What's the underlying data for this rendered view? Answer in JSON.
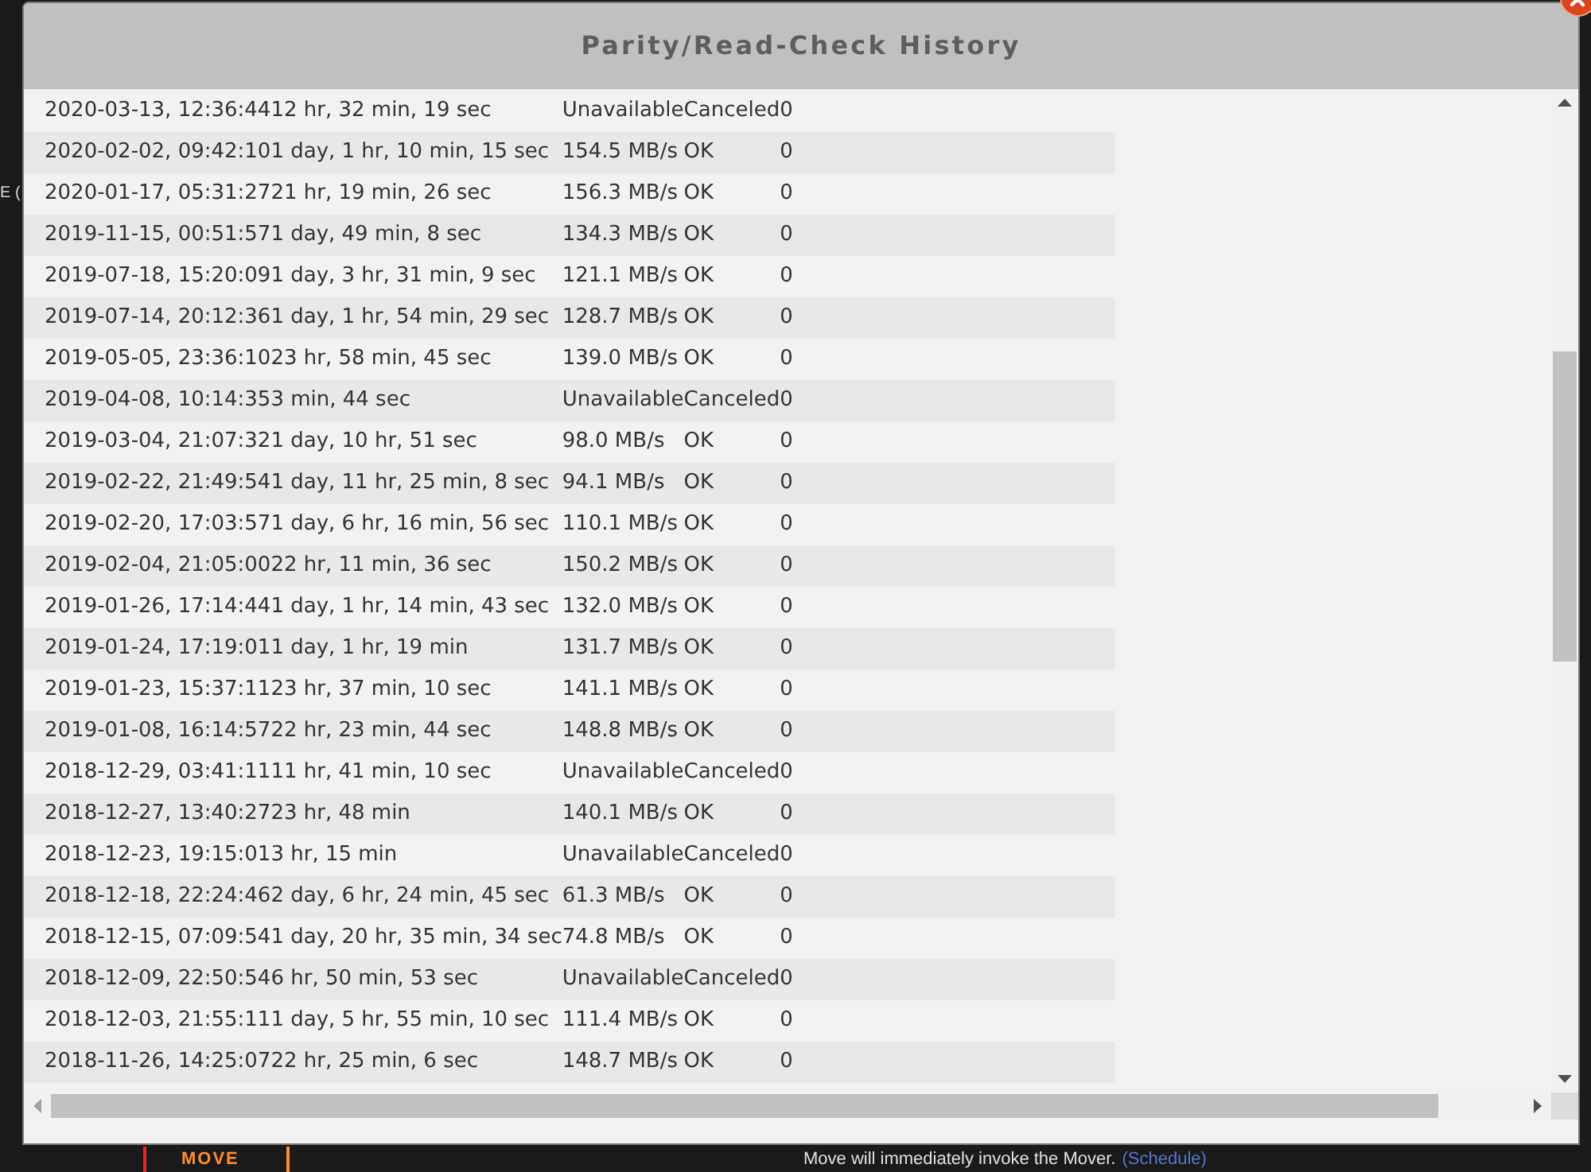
{
  "background": {
    "fragment": "E (",
    "move_button": "MOVE",
    "move_note": {
      "text": "Move will immediately invoke the Mover.",
      "link": "(Schedule)"
    }
  },
  "dialog": {
    "title": "Parity/Read-Check History",
    "rows": [
      {
        "date": "2020-03-13, 12:36:44",
        "duration": "12 hr, 32 min, 19 sec",
        "speed": "Unavailable",
        "status": "Canceled",
        "errors": "0"
      },
      {
        "date": "2020-02-02, 09:42:10",
        "duration": "1 day, 1 hr, 10 min, 15 sec",
        "speed": "154.5 MB/s",
        "status": "OK",
        "errors": "0"
      },
      {
        "date": "2020-01-17, 05:31:27",
        "duration": "21 hr, 19 min, 26 sec",
        "speed": "156.3 MB/s",
        "status": "OK",
        "errors": "0"
      },
      {
        "date": "2019-11-15, 00:51:57",
        "duration": "1 day, 49 min, 8 sec",
        "speed": "134.3 MB/s",
        "status": "OK",
        "errors": "0"
      },
      {
        "date": "2019-07-18, 15:20:09",
        "duration": "1 day, 3 hr, 31 min, 9 sec",
        "speed": "121.1 MB/s",
        "status": "OK",
        "errors": "0"
      },
      {
        "date": "2019-07-14, 20:12:36",
        "duration": "1 day, 1 hr, 54 min, 29 sec",
        "speed": "128.7 MB/s",
        "status": "OK",
        "errors": "0"
      },
      {
        "date": "2019-05-05, 23:36:10",
        "duration": "23 hr, 58 min, 45 sec",
        "speed": "139.0 MB/s",
        "status": "OK",
        "errors": "0"
      },
      {
        "date": "2019-04-08, 10:14:35",
        "duration": "3 min, 44 sec",
        "speed": "Unavailable",
        "status": "Canceled",
        "errors": "0"
      },
      {
        "date": "2019-03-04, 21:07:32",
        "duration": "1 day, 10 hr, 51 sec",
        "speed": "98.0 MB/s",
        "status": "OK",
        "errors": "0"
      },
      {
        "date": "2019-02-22, 21:49:54",
        "duration": "1 day, 11 hr, 25 min, 8 sec",
        "speed": "94.1 MB/s",
        "status": "OK",
        "errors": "0"
      },
      {
        "date": "2019-02-20, 17:03:57",
        "duration": "1 day, 6 hr, 16 min, 56 sec",
        "speed": "110.1 MB/s",
        "status": "OK",
        "errors": "0"
      },
      {
        "date": "2019-02-04, 21:05:00",
        "duration": "22 hr, 11 min, 36 sec",
        "speed": "150.2 MB/s",
        "status": "OK",
        "errors": "0"
      },
      {
        "date": "2019-01-26, 17:14:44",
        "duration": "1 day, 1 hr, 14 min, 43 sec",
        "speed": "132.0 MB/s",
        "status": "OK",
        "errors": "0"
      },
      {
        "date": "2019-01-24, 17:19:01",
        "duration": "1 day, 1 hr, 19 min",
        "speed": "131.7 MB/s",
        "status": "OK",
        "errors": "0"
      },
      {
        "date": "2019-01-23, 15:37:11",
        "duration": "23 hr, 37 min, 10 sec",
        "speed": "141.1 MB/s",
        "status": "OK",
        "errors": "0"
      },
      {
        "date": "2019-01-08, 16:14:57",
        "duration": "22 hr, 23 min, 44 sec",
        "speed": "148.8 MB/s",
        "status": "OK",
        "errors": "0"
      },
      {
        "date": "2018-12-29, 03:41:11",
        "duration": "11 hr, 41 min, 10 sec",
        "speed": "Unavailable",
        "status": "Canceled",
        "errors": "0"
      },
      {
        "date": "2018-12-27, 13:40:27",
        "duration": "23 hr, 48 min",
        "speed": "140.1 MB/s",
        "status": "OK",
        "errors": "0"
      },
      {
        "date": "2018-12-23, 19:15:01",
        "duration": "3 hr, 15 min",
        "speed": "Unavailable",
        "status": "Canceled",
        "errors": "0"
      },
      {
        "date": "2018-12-18, 22:24:46",
        "duration": "2 day, 6 hr, 24 min, 45 sec",
        "speed": "61.3 MB/s",
        "status": "OK",
        "errors": "0"
      },
      {
        "date": "2018-12-15, 07:09:54",
        "duration": "1 day, 20 hr, 35 min, 34 sec",
        "speed": "74.8 MB/s",
        "status": "OK",
        "errors": "0"
      },
      {
        "date": "2018-12-09, 22:50:54",
        "duration": "6 hr, 50 min, 53 sec",
        "speed": "Unavailable",
        "status": "Canceled",
        "errors": "0"
      },
      {
        "date": "2018-12-03, 21:55:11",
        "duration": "1 day, 5 hr, 55 min, 10 sec",
        "speed": "111.4 MB/s",
        "status": "OK",
        "errors": "0"
      },
      {
        "date": "2018-11-26, 14:25:07",
        "duration": "22 hr, 25 min, 6 sec",
        "speed": "148.7 MB/s",
        "status": "OK",
        "errors": "0"
      }
    ]
  }
}
